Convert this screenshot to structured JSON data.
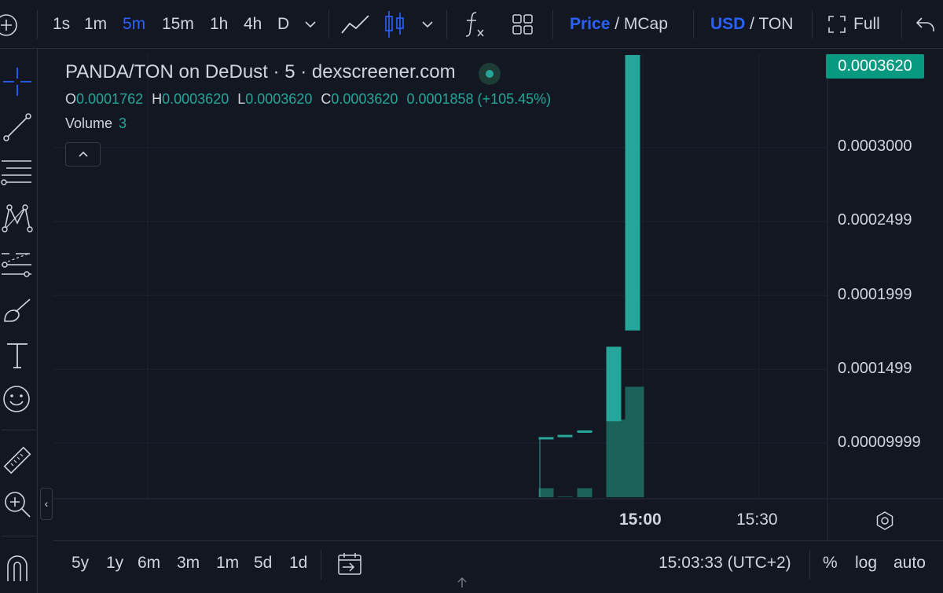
{
  "toolbar": {
    "intervals": [
      "1s",
      "1m",
      "5m",
      "15m",
      "1h",
      "4h",
      "D"
    ],
    "active_interval": "5m",
    "price_label": "Price",
    "price_sep": " / ",
    "mcap_label": "MCap",
    "usd_label": "USD",
    "usd_sep": " / ",
    "ton_label": "TON",
    "full_label": "Full"
  },
  "legend": {
    "title": "PANDA/TON on DeDust · 5 · dexscreener.com",
    "o_key": "O",
    "o_val": "0.0001762",
    "h_key": "H",
    "h_val": "0.0003620",
    "l_key": "L",
    "l_val": "0.0003620",
    "c_key": "C",
    "c_val": "0.0003620",
    "change": "0.0001858 (+105.45%)",
    "volume_label": "Volume",
    "volume_value": "3"
  },
  "price_axis": {
    "last_price": "0.0003620",
    "labels": [
      "0.0003000",
      "0.0002499",
      "0.0001999",
      "0.0001499",
      "0.00009999"
    ]
  },
  "time_axis": {
    "labels": [
      "15:00",
      "15:30"
    ]
  },
  "bottombar": {
    "ranges": [
      "5y",
      "1y",
      "6m",
      "3m",
      "1m",
      "5d",
      "1d"
    ],
    "clock": "15:03:33 (UTC+2)",
    "percent_label": "%",
    "log_label": "log",
    "auto_label": "auto"
  },
  "colors": {
    "background": "#131722",
    "up": "#26a69a",
    "volume": "#1d6b60",
    "accent": "#2962ff",
    "price_tag": "#089981"
  },
  "chart_data": {
    "type": "candlestick",
    "symbol": "PANDA/TON",
    "interval": "5",
    "y_axis_ticks": [
      0.0003,
      0.0002499,
      0.0001999,
      0.0001499,
      9.999e-05
    ],
    "candles": [
      {
        "open": 0.000103,
        "high": 0.000103,
        "low": 0.0,
        "close": 0.000104,
        "volume": 0.15
      },
      {
        "open": 0.0001045,
        "high": 0.0001045,
        "low": 0.0001045,
        "close": 0.0001055,
        "volume": 0.01
      },
      {
        "open": 0.0001075,
        "high": 0.0001075,
        "low": 0.0001075,
        "close": 0.0001085,
        "volume": 0.15
      },
      {
        "open": 0.0001147,
        "high": 0.0001652,
        "low": 0.0001147,
        "close": 0.0001652,
        "volume": 1.3
      },
      {
        "open": 0.0001762,
        "high": 0.000362,
        "low": 0.0001762,
        "close": 0.000362,
        "volume": 1.85
      }
    ]
  }
}
